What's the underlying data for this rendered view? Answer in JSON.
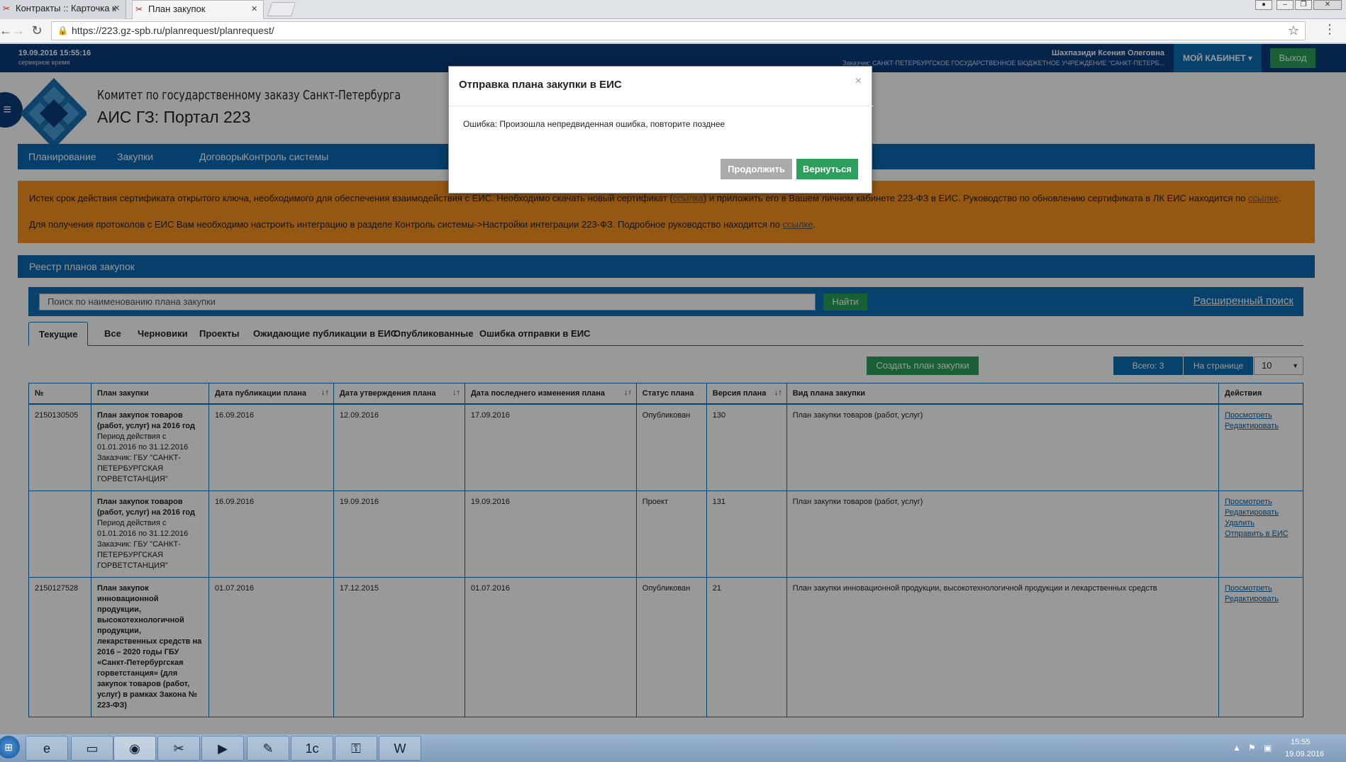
{
  "browser": {
    "tabs": [
      {
        "title": "Контракты :: Карточка к"
      },
      {
        "title": "План закупок"
      }
    ],
    "url": "https://223.gz-spb.ru/planrequest/planrequest/"
  },
  "topbar": {
    "datetime": "19.09.2016 15:55:16",
    "tz_note": "серверное время",
    "user_name": "Шахпазиди Ксения Олеговна",
    "customer": "Заказчик: САНКТ-ПЕТЕРБУРГСКОЕ ГОСУДАРСТВЕННОЕ БЮДЖЕТНОЕ УЧРЕЖДЕНИЕ \"САНКТ-ПЕТЕРБ...",
    "cabinet_label": "МОЙ КАБИНЕТ",
    "logout_label": "Выход"
  },
  "header": {
    "committee": "Комитет по государственному заказу Санкт-Петербурга",
    "portal": "АИС ГЗ: Портал 223"
  },
  "nav": [
    "Планирование",
    "Закупки",
    "Договоры",
    "Контроль системы"
  ],
  "alert": {
    "line1_pre": "Истек срок действия сертификата открытого ключа, необходимого для обеспечения взаимодействия с ЕИС. Необходимо скачать новый сертификат (",
    "line1_link1": "ссылка",
    "line1_mid": ") и приложить его в Вашем личном кабинете 223-ФЗ в ЕИС. Руководство по обновлению сертификата в ЛК ЕИС находится по ",
    "line1_link2": "ссылке",
    "line1_end": ".",
    "line2_pre": "Для получения протоколов с ЕИС Вам необходимо настроить интеграцию в разделе Контроль системы->Настройки интеграции 223-ФЗ. Подробное руководство находится по ",
    "line2_link": "ссылке",
    "line2_end": "."
  },
  "registry": {
    "title": "Реестр планов закупок",
    "search_placeholder": "Поиск по наименованию плана закупки",
    "search_button": "Найти",
    "advanced_search": "Расширенный поиск",
    "tabs": [
      "Текущие",
      "Все",
      "Черновики",
      "Проекты",
      "Ожидающие публикации в ЕИС",
      "Опубликованные",
      "Ошибка отправки в ЕИС"
    ],
    "create_button": "Создать план закупки",
    "total": "Всего: 3",
    "per_page_label": "На странице",
    "per_page_value": "10",
    "columns": [
      "№",
      "План закупки",
      "Дата публикации плана",
      "Дата утверждения плана",
      "Дата последнего изменения плана",
      "Статус плана",
      "Версия плана",
      "Вид плана закупки",
      "Действия"
    ],
    "rows": [
      {
        "num": "2150130505",
        "plan_title": "План закупок товаров (работ, услуг) на 2016 год",
        "period": "Период действия с 01.01.2016 по 31.12.2016",
        "customer": "Заказчик: ГБУ \"САНКТ-ПЕТЕРБУРГСКАЯ ГОРВЕТСТАНЦИЯ\"",
        "pub_date": "16.09.2016",
        "approve_date": "12.09.2016",
        "change_date": "17.09.2016",
        "status": "Опубликован",
        "version": "130",
        "kind": "План закупки товаров (работ, услуг)",
        "actions": [
          "Просмотреть",
          "Редактировать"
        ]
      },
      {
        "num": "",
        "plan_title": "План закупок товаров (работ, услуг) на 2016 год",
        "period": "Период действия с 01.01.2016 по 31.12.2016",
        "customer": "Заказчик: ГБУ \"САНКТ-ПЕТЕРБУРГСКАЯ ГОРВЕТСТАНЦИЯ\"",
        "pub_date": "16.09.2016",
        "approve_date": "19.09.2016",
        "change_date": "19.09.2016",
        "status": "Проект",
        "version": "131",
        "kind": "План закупки товаров (работ, услуг)",
        "actions": [
          "Просмотреть",
          "Редактировать",
          "Удалить",
          "Отправить в ЕИС"
        ]
      },
      {
        "num": "2150127528",
        "plan_title": "План закупок инновационной продукции, высокотехнологичной продукции, лекарственных средств на 2016 – 2020 годы ГБУ «Санкт-Петербургская горветстанция» (для закупок товаров (работ, услуг) в рамках Закона № 223-ФЗ)",
        "period": "",
        "customer": "",
        "pub_date": "01.07.2016",
        "approve_date": "17.12.2015",
        "change_date": "01.07.2016",
        "status": "Опубликован",
        "version": "21",
        "kind": "План закупки инновационной продукции, высокотехнологичной продукции и лекарственных средств",
        "actions": [
          "Просмотреть",
          "Редактировать"
        ]
      }
    ]
  },
  "modal": {
    "title": "Отправка плана закупки в ЕИС",
    "close": "×",
    "message": "Ошибка: Произошла непредвиденная ошибка, повторите позднее",
    "continue_label": "Продолжить",
    "back_label": "Вернуться"
  },
  "taskbar": {
    "time": "15:55",
    "date": "19.09.2016"
  }
}
